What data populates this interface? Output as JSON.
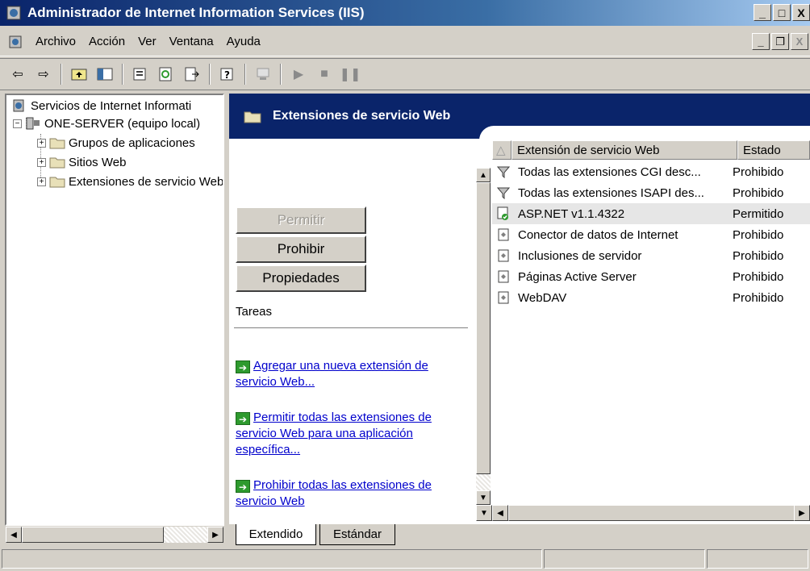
{
  "window": {
    "title": "Administrador de Internet Information Services (IIS)",
    "minimize_label": "_",
    "maximize_label": "□",
    "close_label": "X"
  },
  "menu": {
    "items": [
      {
        "label": "Archivo"
      },
      {
        "label": "Acción"
      },
      {
        "label": "Ver"
      },
      {
        "label": "Ventana"
      },
      {
        "label": "Ayuda"
      }
    ],
    "mdi_minimize": "_",
    "mdi_restore": "❐",
    "mdi_close": "X"
  },
  "tree": {
    "root": "Servicios de Internet Informati",
    "server": "ONE-SERVER (equipo local)",
    "children": [
      {
        "label": "Grupos de aplicaciones"
      },
      {
        "label": "Sitios Web"
      },
      {
        "label": "Extensiones de servicio Web"
      }
    ],
    "expander_minus": "−",
    "expander_plus": "+"
  },
  "panel": {
    "header_title": "Extensiones de servicio Web",
    "buttons": {
      "allow": "Permitir",
      "prohibit": "Prohibir",
      "properties": "Propiedades"
    },
    "tasks_label": "Tareas",
    "tasks": [
      {
        "text": "Agregar una nueva extensión de servicio Web..."
      },
      {
        "text": "Permitir todas las extensiones de servicio Web para una aplicación específica..."
      },
      {
        "text": "Prohibir todas las extensiones de servicio Web"
      }
    ]
  },
  "list": {
    "columns": [
      {
        "label": "Extensión de servicio Web"
      },
      {
        "label": "Estado"
      }
    ],
    "rows": [
      {
        "name": "Todas las extensiones CGI desc...",
        "status": "Prohibido",
        "icon": "filter-icon"
      },
      {
        "name": "Todas las extensiones ISAPI des...",
        "status": "Prohibido",
        "icon": "filter-icon"
      },
      {
        "name": "ASP.NET v1.1.4322",
        "status": "Permitido",
        "icon": "allowed-extension-icon"
      },
      {
        "name": "Conector de datos de Internet",
        "status": "Prohibido",
        "icon": "extension-icon"
      },
      {
        "name": "Inclusiones de servidor",
        "status": "Prohibido",
        "icon": "extension-icon"
      },
      {
        "name": "Páginas Active Server",
        "status": "Prohibido",
        "icon": "extension-icon"
      },
      {
        "name": "WebDAV",
        "status": "Prohibido",
        "icon": "extension-icon"
      }
    ]
  },
  "tabs": [
    {
      "label": "Extendido"
    },
    {
      "label": "Estándar"
    }
  ],
  "colors": {
    "header_band": "#0a246a",
    "link": "#0000cc",
    "face": "#d4d0c8"
  }
}
